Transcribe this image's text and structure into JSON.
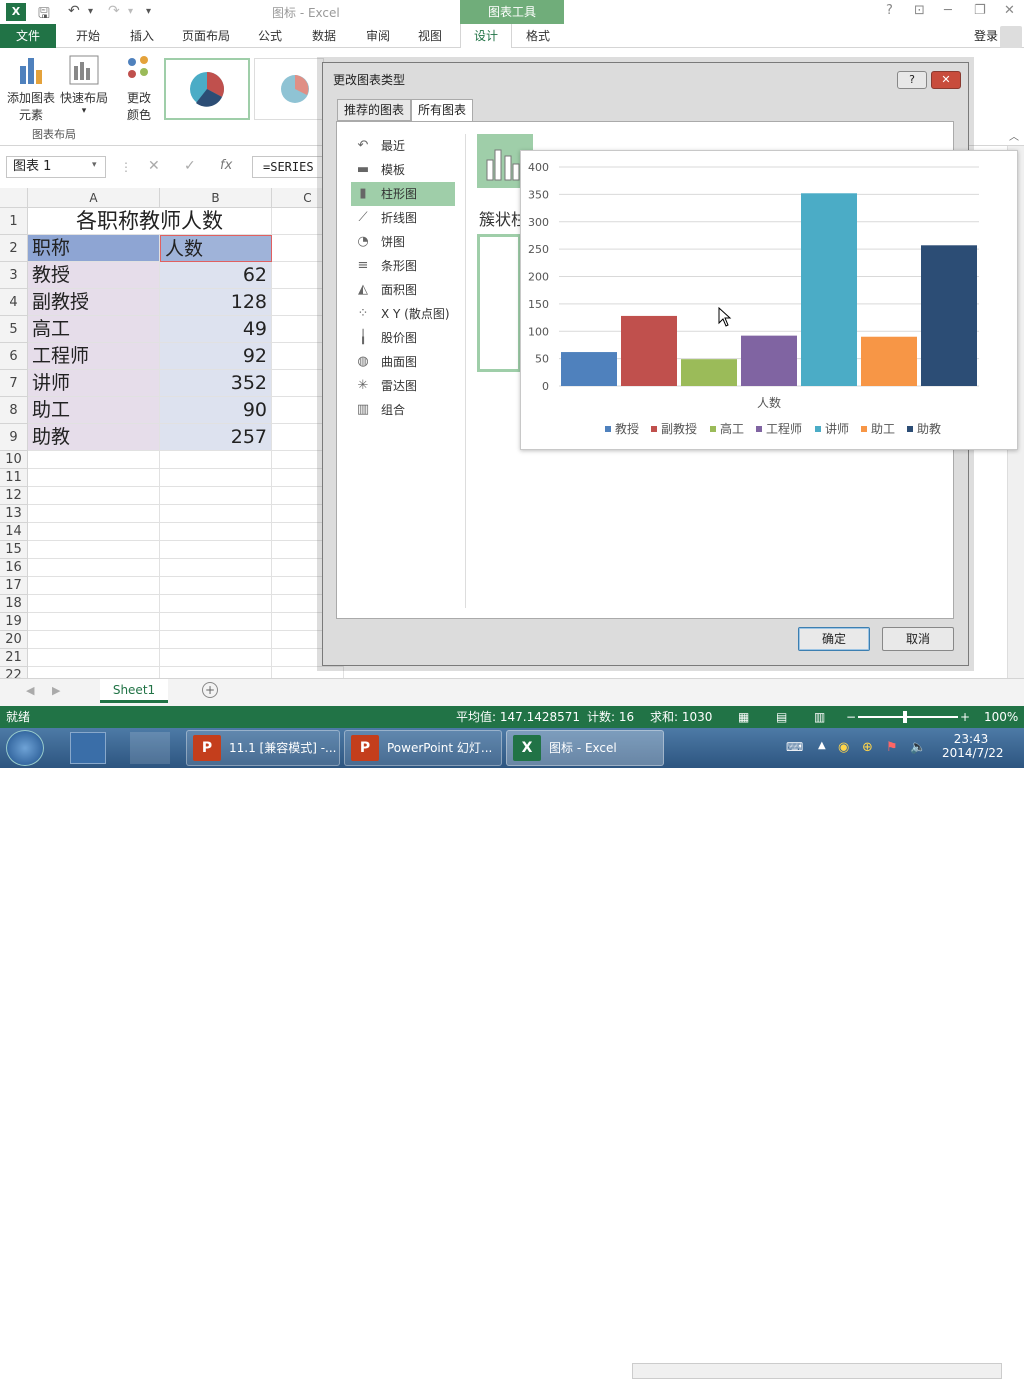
{
  "window": {
    "title": "图标 - Excel",
    "chart_tools_label": "图表工具",
    "login": "登录"
  },
  "tabs": [
    "开始",
    "插入",
    "页面布局",
    "公式",
    "数据",
    "审阅",
    "视图"
  ],
  "tab_file": "文件",
  "tab_design": "设计",
  "tab_format": "格式",
  "ribbon": {
    "add_chart_element": "添加图表\n元素",
    "add_chart_element_l1": "添加图表",
    "add_chart_element_l2": "元素",
    "quick_layout_l1": "快速布局",
    "change_colors_l1": "更改",
    "change_colors_l2": "颜色",
    "group_layout": "图表布局"
  },
  "formula": {
    "namebox": "图表 1",
    "fx": "fx",
    "content": "=SERIES"
  },
  "sheet": {
    "columns": [
      "A",
      "B",
      "C"
    ],
    "rows": [
      "1",
      "2",
      "3",
      "4",
      "5",
      "6",
      "7",
      "8",
      "9",
      "10",
      "11",
      "12",
      "13",
      "14",
      "15",
      "16",
      "17",
      "18",
      "19",
      "20",
      "21",
      "22"
    ],
    "title": "各职称教师人数",
    "header_a": "职称",
    "header_b": "人数",
    "data": [
      {
        "a": "教授",
        "b": "62"
      },
      {
        "a": "副教授",
        "b": "128"
      },
      {
        "a": "高工",
        "b": "49"
      },
      {
        "a": "工程师",
        "b": "92"
      },
      {
        "a": "讲师",
        "b": "352"
      },
      {
        "a": "助工",
        "b": "90"
      },
      {
        "a": "助教",
        "b": "257"
      }
    ]
  },
  "sheet_tab": "Sheet1",
  "status": {
    "ready": "就绪",
    "average": "平均值: 147.1428571",
    "count": "计数: 16",
    "sum": "求和: 1030",
    "zoom": "100%"
  },
  "dialog": {
    "title": "更改图表类型",
    "help": "?",
    "close": "✕",
    "tab_recommended": "推荐的图表",
    "tab_all": "所有图表",
    "categories": [
      {
        "label": "最近",
        "icon": "↶"
      },
      {
        "label": "模板",
        "icon": "▬"
      },
      {
        "label": "柱形图",
        "icon": "▮"
      },
      {
        "label": "折线图",
        "icon": "⟋"
      },
      {
        "label": "饼图",
        "icon": "◔"
      },
      {
        "label": "条形图",
        "icon": "≡"
      },
      {
        "label": "面积图",
        "icon": "◭"
      },
      {
        "label": "X Y (散点图)",
        "icon": "⁘"
      },
      {
        "label": "股价图",
        "icon": "╽"
      },
      {
        "label": "曲面图",
        "icon": "◍"
      },
      {
        "label": "雷达图",
        "icon": "✳"
      },
      {
        "label": "组合",
        "icon": "▥"
      }
    ],
    "subtype_title": "簇状柱",
    "ok": "确定",
    "cancel": "取消"
  },
  "chart_data": {
    "type": "bar",
    "categories": [
      "人数"
    ],
    "xlabel": "人数",
    "ylim": [
      0,
      400
    ],
    "yticks": [
      0,
      50,
      100,
      150,
      200,
      250,
      300,
      350,
      400
    ],
    "grid": true,
    "legend": "bottom",
    "series": [
      {
        "name": "教授",
        "values": [
          62
        ],
        "color": "#4f81bd"
      },
      {
        "name": "副教授",
        "values": [
          128
        ],
        "color": "#c0504d"
      },
      {
        "name": "高工",
        "values": [
          49
        ],
        "color": "#9bbb59"
      },
      {
        "name": "工程师",
        "values": [
          92
        ],
        "color": "#8064a2"
      },
      {
        "name": "讲师",
        "values": [
          352
        ],
        "color": "#4bacc6"
      },
      {
        "name": "助工",
        "values": [
          90
        ],
        "color": "#f79646"
      },
      {
        "name": "助教",
        "values": [
          257
        ],
        "color": "#2c4d75"
      }
    ]
  },
  "taskbar": {
    "items": [
      "11.1 [兼容模式] -...",
      "PowerPoint 幻灯...",
      "图标 - Excel"
    ],
    "time": "23:43",
    "date": "2014/7/22"
  }
}
